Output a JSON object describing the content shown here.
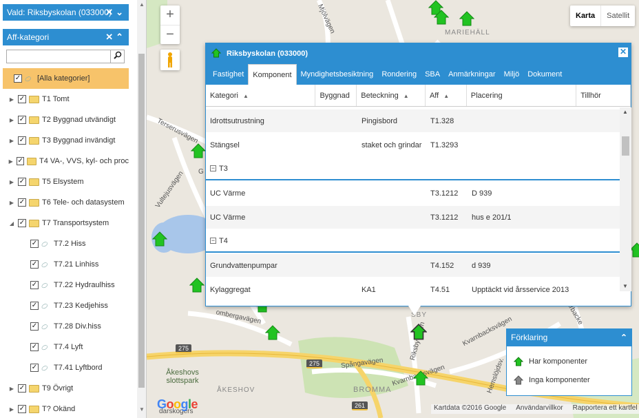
{
  "sidebar": {
    "selected_header": "Vald: Riksbyskolan (033000)",
    "category_header": "Aff-kategori",
    "search_placeholder": "",
    "tree": [
      {
        "label": "[Alla kategorier]",
        "level": 0,
        "expander": "",
        "icon": "tag",
        "selected": true
      },
      {
        "label": "T1 Tomt",
        "level": 0,
        "expander": "collapsed",
        "icon": "folder"
      },
      {
        "label": "T2 Byggnad utvändigt",
        "level": 0,
        "expander": "collapsed",
        "icon": "folder"
      },
      {
        "label": "T3 Byggnad invändigt",
        "level": 0,
        "expander": "collapsed",
        "icon": "folder"
      },
      {
        "label": "T4 VA-, VVS, kyl- och proc",
        "level": 0,
        "expander": "collapsed",
        "icon": "folder"
      },
      {
        "label": "T5 Elsystem",
        "level": 0,
        "expander": "collapsed",
        "icon": "folder"
      },
      {
        "label": "T6 Tele- och datasystem",
        "level": 0,
        "expander": "collapsed",
        "icon": "folder"
      },
      {
        "label": "T7 Transportsystem",
        "level": 0,
        "expander": "expanded",
        "icon": "folder"
      },
      {
        "label": "T7.2 Hiss",
        "level": 1,
        "expander": "",
        "icon": "tag"
      },
      {
        "label": "T7.21 Linhiss",
        "level": 1,
        "expander": "",
        "icon": "tag"
      },
      {
        "label": "T7.22 Hydraulhiss",
        "level": 1,
        "expander": "",
        "icon": "tag"
      },
      {
        "label": "T7.23 Kedjehiss",
        "level": 1,
        "expander": "",
        "icon": "tag"
      },
      {
        "label": "T7.28 Div.hiss",
        "level": 1,
        "expander": "",
        "icon": "tag"
      },
      {
        "label": "T7.4 Lyft",
        "level": 1,
        "expander": "",
        "icon": "tag"
      },
      {
        "label": "T7.41 Lyftbord",
        "level": 1,
        "expander": "",
        "icon": "tag"
      },
      {
        "label": "T9 Övrigt",
        "level": 0,
        "expander": "collapsed",
        "icon": "folder"
      },
      {
        "label": "T? Okänd",
        "level": 0,
        "expander": "collapsed",
        "icon": "folder"
      }
    ]
  },
  "map": {
    "zoom_in": "+",
    "zoom_out": "−",
    "type_map": "Karta",
    "type_satellite": "Satellit",
    "attribution": {
      "data": "Kartdata ©2016 Google",
      "terms": "Användarvillkor",
      "report": "Rapportera ett kartfel"
    },
    "labels": {
      "mjolvagen": "Mjölvägen",
      "mariehall": "MARIEHÄLL",
      "terserusvagen": "Terserusvägen",
      "vultejusvagen": "Vultejusvägen",
      "ombergavagen": "ombergavägen",
      "spangavagen": "Spångavägen",
      "riksbyvagen": "Riksbyvägen",
      "kvarnbacksvagen": "Kvarnbacksvägen",
      "kvarnbacksvagen2": "Kvarnbacksvägen",
      "hemslojdsv": "Hemslöjdsv.",
      "akeshov_park": "Åkeshovs slottspark",
      "akeshov": "ÅKESHOV",
      "bromma": "BROMMA",
      "sby": "SBY",
      "ga": "G",
      "arbacke": "arbacke",
      "road_275a": "275",
      "road_275b": "275",
      "road_261": "261",
      "darskogers": "darskogers"
    }
  },
  "popup": {
    "title": "Riksbyskolan (033000)",
    "close": "✕",
    "tabs": [
      "Fastighet",
      "Komponent",
      "Myndighetsbesiktning",
      "Rondering",
      "SBA",
      "Anmärkningar",
      "Miljö",
      "Dokument"
    ],
    "active_tab": 1,
    "columns": [
      "Kategori",
      "Byggnad",
      "Beteckning",
      "Aff",
      "Placering",
      "Tillhör"
    ],
    "rows": [
      {
        "type": "data",
        "kategori": "Idrottsutrustning",
        "byggnad": "",
        "beteckning": "Pingisbord",
        "aff": "T1.328",
        "placering": ""
      },
      {
        "type": "data",
        "kategori": "Stängsel",
        "byggnad": "",
        "beteckning": "staket och grindar",
        "aff": "T1.3293",
        "placering": ""
      },
      {
        "type": "group",
        "kategori": "T3"
      },
      {
        "type": "data",
        "kategori": "UC Värme",
        "byggnad": "",
        "beteckning": "",
        "aff": "T3.1212",
        "placering": "D 939"
      },
      {
        "type": "data",
        "kategori": "UC Värme",
        "byggnad": "",
        "beteckning": "",
        "aff": "T3.1212",
        "placering": "hus e 201/1"
      },
      {
        "type": "group",
        "kategori": "T4"
      },
      {
        "type": "data",
        "kategori": "Grundvattenpumpar",
        "byggnad": "",
        "beteckning": "",
        "aff": "T4.152",
        "placering": "d 939"
      },
      {
        "type": "data",
        "kategori": "Kylaggregat",
        "byggnad": "",
        "beteckning": "KA1",
        "aff": "T4.51",
        "placering": "Upptäckt vid årsservice 2013"
      }
    ]
  },
  "legend": {
    "title": "Förklaring",
    "items": [
      {
        "label": "Har komponenter",
        "color": "#22c322"
      },
      {
        "label": "Inga komponenter",
        "color": "#888888"
      }
    ]
  },
  "colors": {
    "accent": "#2d8ed1",
    "selected_row": "#f7c36a",
    "marker_green": "#22c322"
  }
}
